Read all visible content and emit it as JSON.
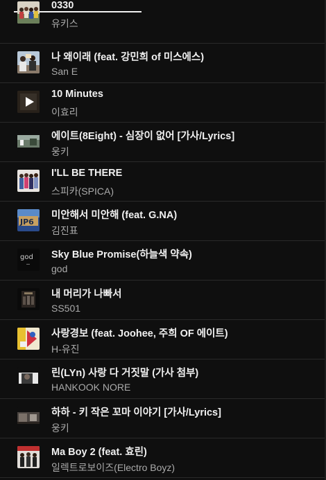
{
  "playlist": {
    "items": [
      {
        "title": "0330",
        "artist": "유키스"
      },
      {
        "title": "나 왜이래 (feat. 강민희 of 미스에스)",
        "artist": "San E"
      },
      {
        "title": "10 Minutes",
        "artist": "이효리",
        "now_playing": true
      },
      {
        "title": "에이트(8Eight) - 심장이 없어 [가사/Lyrics]",
        "artist": "웅키"
      },
      {
        "title": "I'LL BE THERE",
        "artist": "스피카(SPICA)"
      },
      {
        "title": "미안해서 미안해 (feat. G.NA)",
        "artist": "김진표"
      },
      {
        "title": "Sky Blue Promise(하늘색 약속)",
        "artist": "god"
      },
      {
        "title": "내 머리가 나빠서",
        "artist": "SS501"
      },
      {
        "title": "사랑경보 (feat. Joohee, 주희 OF 에이트)",
        "artist": "H-유진"
      },
      {
        "title": "린(LYn) 사랑 다 거짓말 (가사 첨부)",
        "artist": "HANKOOK NORE"
      },
      {
        "title": "하하 - 키 작은 꼬마 이야기 [가사/Lyrics]",
        "artist": "웅키"
      },
      {
        "title": "Ma Boy 2 (feat. 효린)",
        "artist": "일렉트로보이즈(Electro Boyz)"
      }
    ]
  },
  "thumb_icons": [
    "group-photo-thumbnail",
    "group-photo-thumbnail",
    "play-icon",
    "landscape-thumbnail",
    "group-photo-thumbnail",
    "album-cover-thumbnail",
    "god-logo-thumbnail",
    "dark-cover-thumbnail",
    "colorful-cover-thumbnail",
    "portrait-thumbnail",
    "video-still-thumbnail",
    "group-photo-thumbnail"
  ],
  "colors": {
    "background": "#0f0f0f",
    "title_text": "#f1f1f1",
    "secondary_text": "#aaaaaa",
    "divider": "#2a2a2a"
  }
}
